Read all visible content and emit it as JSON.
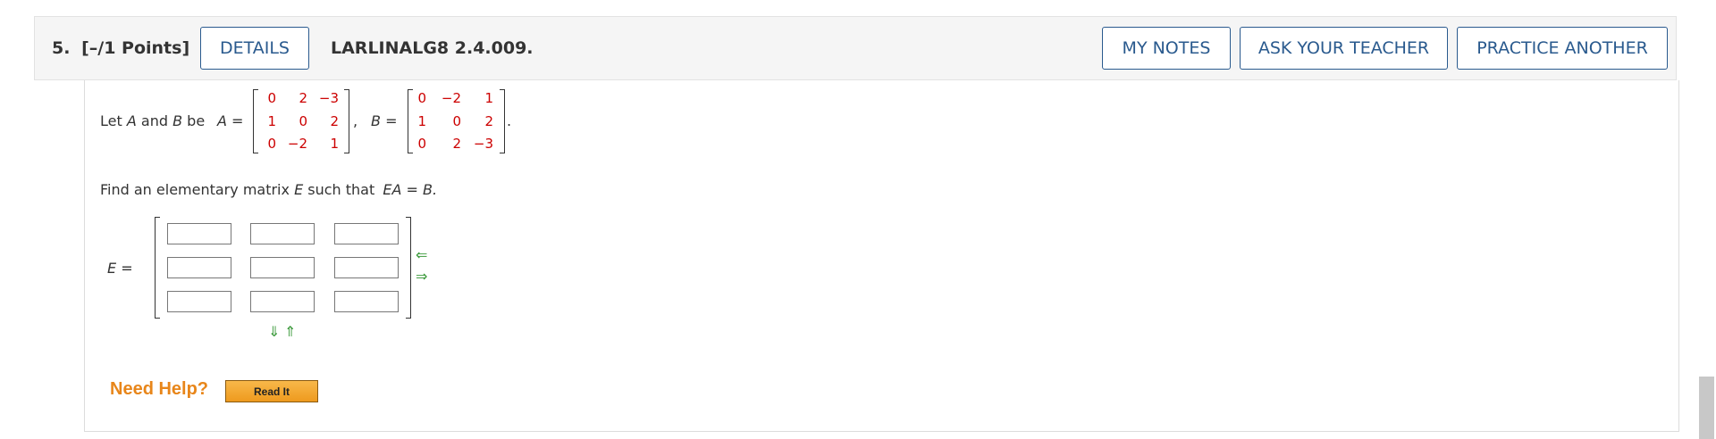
{
  "header": {
    "question_number": "5.",
    "points": "[–/1 Points]",
    "details_label": "DETAILS",
    "problem_code": "LARLINALG8 2.4.009.",
    "my_notes_label": "MY NOTES",
    "ask_teacher_label": "ASK YOUR TEACHER",
    "practice_another_label": "PRACTICE ANOTHER"
  },
  "problem": {
    "intro_prefix": "Let",
    "var_a": "A",
    "and": "and",
    "var_b": "B",
    "be": "be",
    "a_eq": "A =",
    "b_eq": "B =",
    "comma": ",",
    "period": ".",
    "matrix_a": [
      [
        "0",
        "2",
        "−3"
      ],
      [
        "1",
        "0",
        "2"
      ],
      [
        "0",
        "−2",
        "1"
      ]
    ],
    "matrix_b": [
      [
        "0",
        "−2",
        "1"
      ],
      [
        "1",
        "0",
        "2"
      ],
      [
        "0",
        "2",
        "−3"
      ]
    ],
    "find_prefix": "Find an elementary matrix",
    "var_e": "E",
    "find_mid": "such that",
    "equation": "EA = B.",
    "e_eq": "E ="
  },
  "answer_matrix": {
    "rows": 3,
    "cols": 3,
    "values": [
      [
        "",
        "",
        ""
      ],
      [
        "",
        "",
        ""
      ],
      [
        "",
        "",
        ""
      ]
    ],
    "col_remove_icon": "left-arrow-icon",
    "col_add_icon": "right-arrow-icon",
    "row_add_icon": "down-arrow-icon",
    "row_remove_icon": "up-arrow-icon",
    "arrow_color": "#3c9a3c"
  },
  "help": {
    "need_help_label": "Need Help?",
    "read_it_label": "Read It"
  },
  "colors": {
    "link_blue": "#2a5a8e",
    "matrix_red": "#cc0000",
    "help_orange": "#e8861a"
  }
}
